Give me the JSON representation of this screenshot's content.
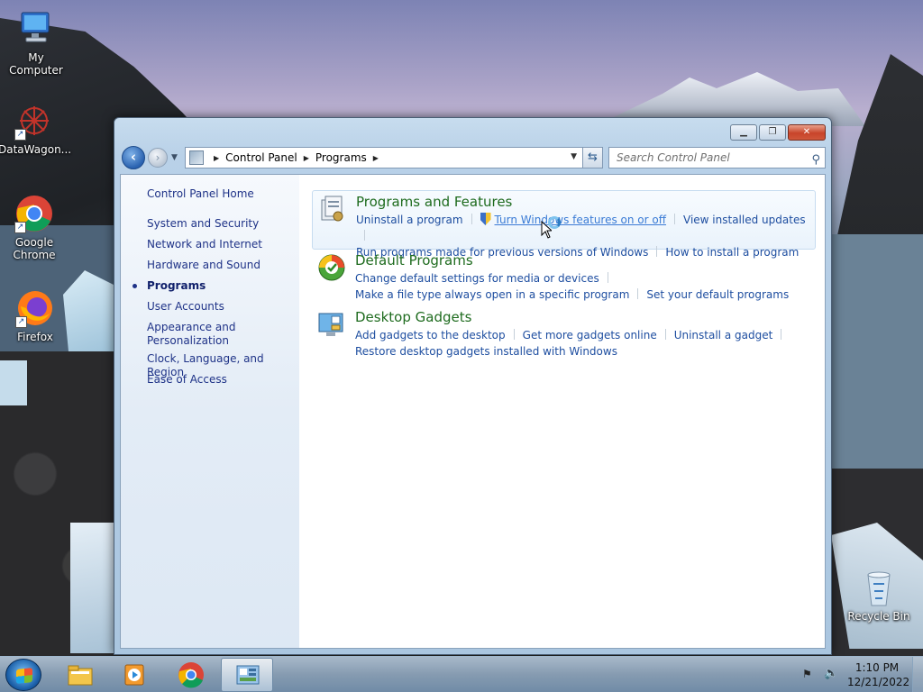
{
  "desktop": {
    "icons": [
      {
        "label": "My Computer"
      },
      {
        "label": "DataWagon..."
      },
      {
        "label": "Google Chrome"
      },
      {
        "label": "Firefox"
      },
      {
        "label": "Recycle Bin"
      }
    ]
  },
  "window": {
    "breadcrumb": [
      "Control Panel",
      "Programs"
    ],
    "search_placeholder": "Search Control Panel",
    "sidebar": {
      "home": "Control Panel Home",
      "items": [
        {
          "label": "System and Security"
        },
        {
          "label": "Network and Internet"
        },
        {
          "label": "Hardware and Sound"
        },
        {
          "label": "Programs",
          "active": true
        },
        {
          "label": "User Accounts"
        },
        {
          "label": "Appearance and Personalization"
        },
        {
          "label": "Clock, Language, and Region"
        },
        {
          "label": "Ease of Access"
        }
      ]
    },
    "categories": [
      {
        "title": "Programs and Features",
        "links": [
          "Uninstall a program",
          "Turn Windows features on or off",
          "View installed updates",
          "Run programs made for previous versions of Windows",
          "How to install a program"
        ]
      },
      {
        "title": "Default Programs",
        "links": [
          "Change default settings for media or devices",
          "Make a file type always open in a specific program",
          "Set your default programs"
        ]
      },
      {
        "title": "Desktop Gadgets",
        "links": [
          "Add gadgets to the desktop",
          "Get more gadgets online",
          "Uninstall a gadget",
          "Restore desktop gadgets installed with Windows"
        ]
      }
    ]
  },
  "taskbar": {
    "time": "1:10 PM",
    "date": "12/21/2022"
  },
  "colors": {
    "link": "#1e4ea0",
    "category_title": "#1e6b1e",
    "sidebar_link": "#1e3287"
  }
}
